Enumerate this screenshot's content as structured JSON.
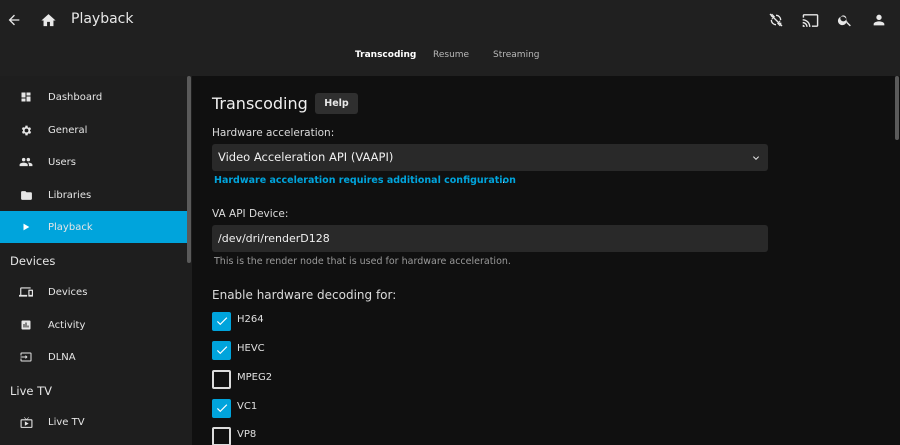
{
  "header": {
    "title": "Playback",
    "tabs": [
      {
        "label": "Transcoding",
        "active": true
      },
      {
        "label": "Resume",
        "active": false
      },
      {
        "label": "Streaming",
        "active": false
      }
    ]
  },
  "sidebar": {
    "items": [
      {
        "label": "Dashboard",
        "icon": "dashboard-icon"
      },
      {
        "label": "General",
        "icon": "gear-icon"
      },
      {
        "label": "Users",
        "icon": "users-icon"
      },
      {
        "label": "Libraries",
        "icon": "folder-icon"
      },
      {
        "label": "Playback",
        "icon": "play-icon",
        "active": true
      }
    ],
    "devices_section": "Devices",
    "devices_items": [
      {
        "label": "Devices",
        "icon": "devices-icon"
      },
      {
        "label": "Activity",
        "icon": "activity-icon"
      },
      {
        "label": "DLNA",
        "icon": "dlna-icon"
      }
    ],
    "livetv_section": "Live TV",
    "livetv_items": [
      {
        "label": "Live TV",
        "icon": "live-tv-icon"
      }
    ]
  },
  "main": {
    "title": "Transcoding",
    "help_label": "Help",
    "hw_accel_label": "Hardware acceleration:",
    "hw_accel_value": "Video Acceleration API (VAAPI)",
    "hw_accel_link": "Hardware acceleration requires additional configuration",
    "hw_accel_link_suffix": ".",
    "va_device_label": "VA API Device:",
    "va_device_value": "/dev/dri/renderD128",
    "va_device_hint": "This is the render node that is used for hardware acceleration.",
    "decoding_label": "Enable hardware decoding for:",
    "codecs": [
      {
        "label": "H264",
        "checked": true
      },
      {
        "label": "HEVC",
        "checked": true
      },
      {
        "label": "MPEG2",
        "checked": false
      },
      {
        "label": "VC1",
        "checked": true
      },
      {
        "label": "VP8",
        "checked": false
      }
    ]
  },
  "colors": {
    "accent": "#00a4dc",
    "header_bg": "#202020",
    "sidebar_bg": "#1e1e1e",
    "page_bg": "#101010"
  }
}
